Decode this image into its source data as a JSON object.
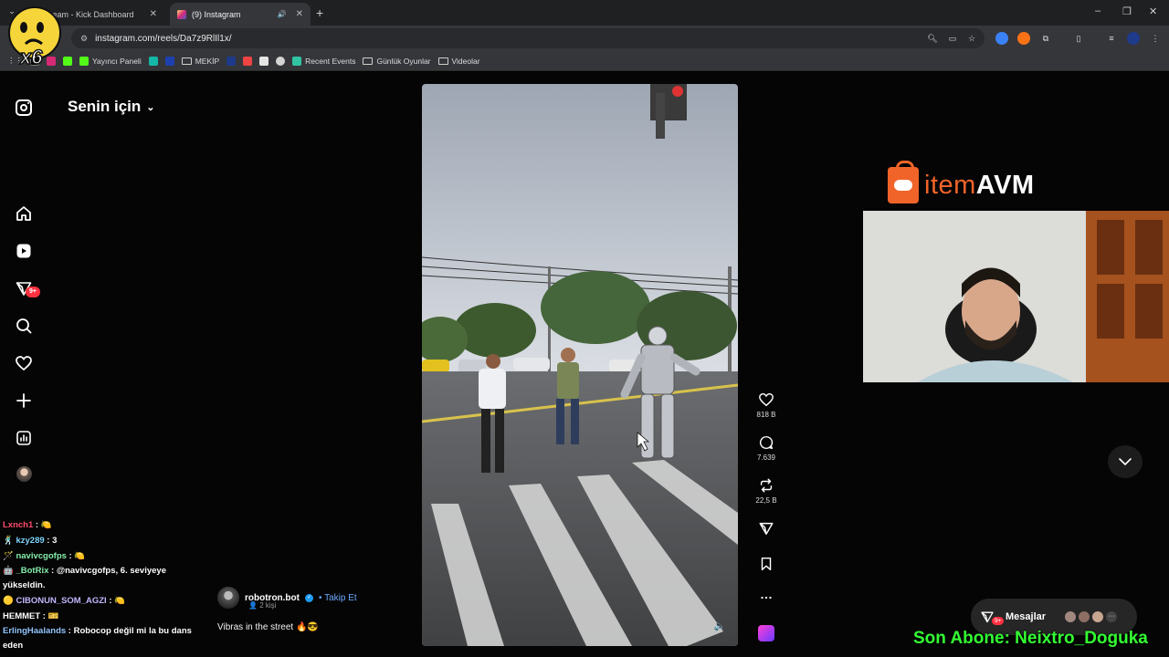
{
  "browser": {
    "tabs": [
      {
        "title": "...eam - Kick Dashboard",
        "active": false
      },
      {
        "title": "(9) Instagram",
        "active": true
      }
    ],
    "url": "instagram.com/reels/Da7z9RlIl1x/",
    "bookmarks": [
      {
        "label": "Yayıncı Paneli"
      },
      {
        "label": "MEKİP"
      },
      {
        "label": "Recent Events"
      },
      {
        "label": "Günlük Oyunlar"
      },
      {
        "label": "Videolar"
      }
    ]
  },
  "overlay": {
    "logo_text": "x6",
    "sponsor": {
      "part1": "item",
      "part2": "AVM"
    },
    "last_sub": "Son Abone: Neixtro_Doguka"
  },
  "instagram": {
    "feed_title": "Senin için",
    "notification_badge": "9+",
    "reel": {
      "author": "robotron.bot",
      "follow_label": "• Takip Et",
      "subline": "2 kişi",
      "caption": "Vibras in the street 🔥😎",
      "likes": "818 B",
      "comments": "7.639",
      "reposts": "22,5 B"
    },
    "messages": {
      "label": "Mesajlar",
      "badge": "9+"
    }
  },
  "chat": [
    {
      "user": "Lxnch1",
      "color": "#ff4d6d",
      "text": " : 🍋"
    },
    {
      "user": "kzy289",
      "color": "#7dd3fc",
      "text": " : 3"
    },
    {
      "user": "navivcgofps",
      "color": "#86efac",
      "text": " : 🍋"
    },
    {
      "user": "_BotRix",
      "color": "#86efac",
      "text": " : @navivcgofps, 6. seviyeye yükseldin."
    },
    {
      "user": "CIBONUN_SOM_AGZI",
      "color": "#c4b5fd",
      "text": " : 🍋"
    },
    {
      "user": "HEMMET",
      "color": "#ffffff",
      "text": " : 🎫"
    },
    {
      "user": "ErlingHaalands",
      "color": "#93c5fd",
      "text": " : Robocop değil mi la bu dans eden"
    }
  ],
  "colors": {
    "instagram_bg": "#050505",
    "sponsor_orange": "#f0642a",
    "sub_banner_green": "#33ff33",
    "badge_red": "#ff3040"
  }
}
